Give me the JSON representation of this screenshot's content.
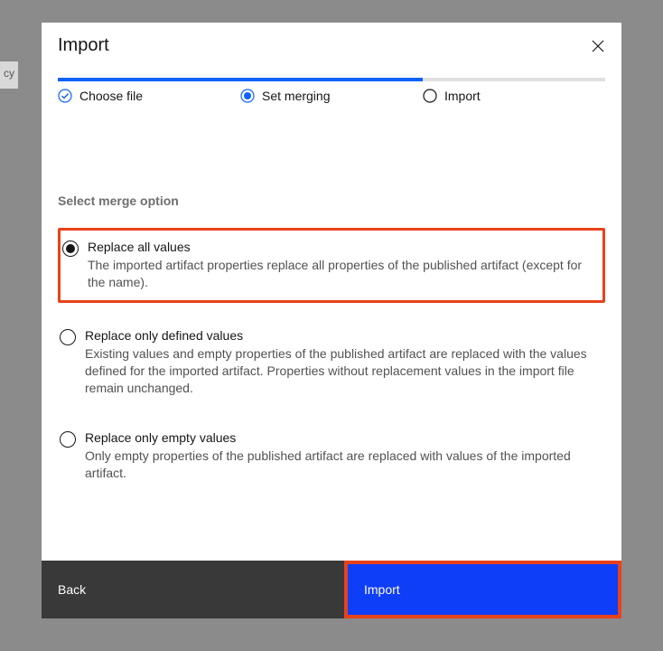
{
  "bg_tab": "cy",
  "modal": {
    "title": "Import",
    "steps": [
      {
        "label": "Choose file"
      },
      {
        "label": "Set merging"
      },
      {
        "label": "Import"
      }
    ],
    "section_label": "Select merge option",
    "options": [
      {
        "title": "Replace all values",
        "description": "The imported artifact properties replace all properties of the published artifact (except for the name)."
      },
      {
        "title": "Replace only defined values",
        "description": "Existing values and empty properties of the published artifact are replaced with the values defined for the imported artifact. Properties without replacement values in the import file remain unchanged."
      },
      {
        "title": "Replace only empty values",
        "description": "Only empty properties of the published artifact are replaced with values of the imported artifact."
      }
    ],
    "footer": {
      "back": "Back",
      "import": "Import"
    }
  }
}
